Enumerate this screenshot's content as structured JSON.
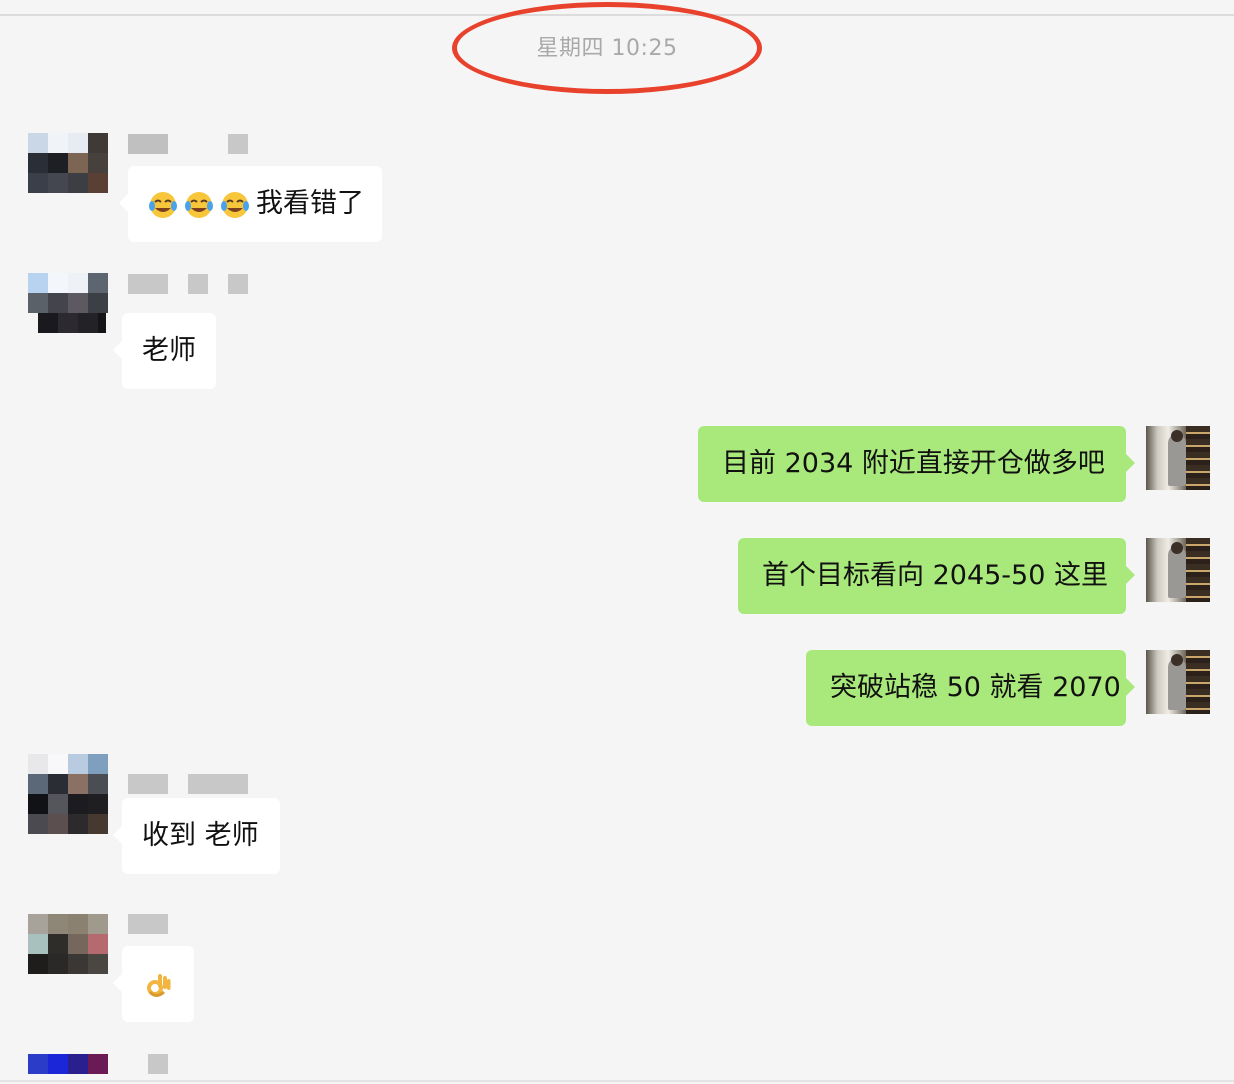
{
  "header": {
    "timestamp": "星期四 10:25"
  },
  "messages": [
    {
      "side": "left",
      "text": "我看错了",
      "emojis": [
        "face-with-tears-of-joy-emoji",
        "face-with-tears-of-joy-emoji",
        "face-with-tears-of-joy-emoji"
      ]
    },
    {
      "side": "left",
      "text": "老师"
    },
    {
      "side": "right",
      "text": "目前 2034 附近直接开仓做多吧"
    },
    {
      "side": "right",
      "text": "首个目标看向 2045-50 这里"
    },
    {
      "side": "right",
      "text": "突破站稳 50 就看 2070"
    },
    {
      "side": "left",
      "text": "收到 老师"
    },
    {
      "side": "left",
      "text": "",
      "emojis": [
        "ok-hand-emoji"
      ]
    }
  ],
  "colors": {
    "background": "#f5f5f5",
    "sent_bubble": "#a9e87b",
    "received_bubble": "#ffffff",
    "timestamp_text": "#a9a9a9",
    "highlight_oval": "#e8412c"
  }
}
